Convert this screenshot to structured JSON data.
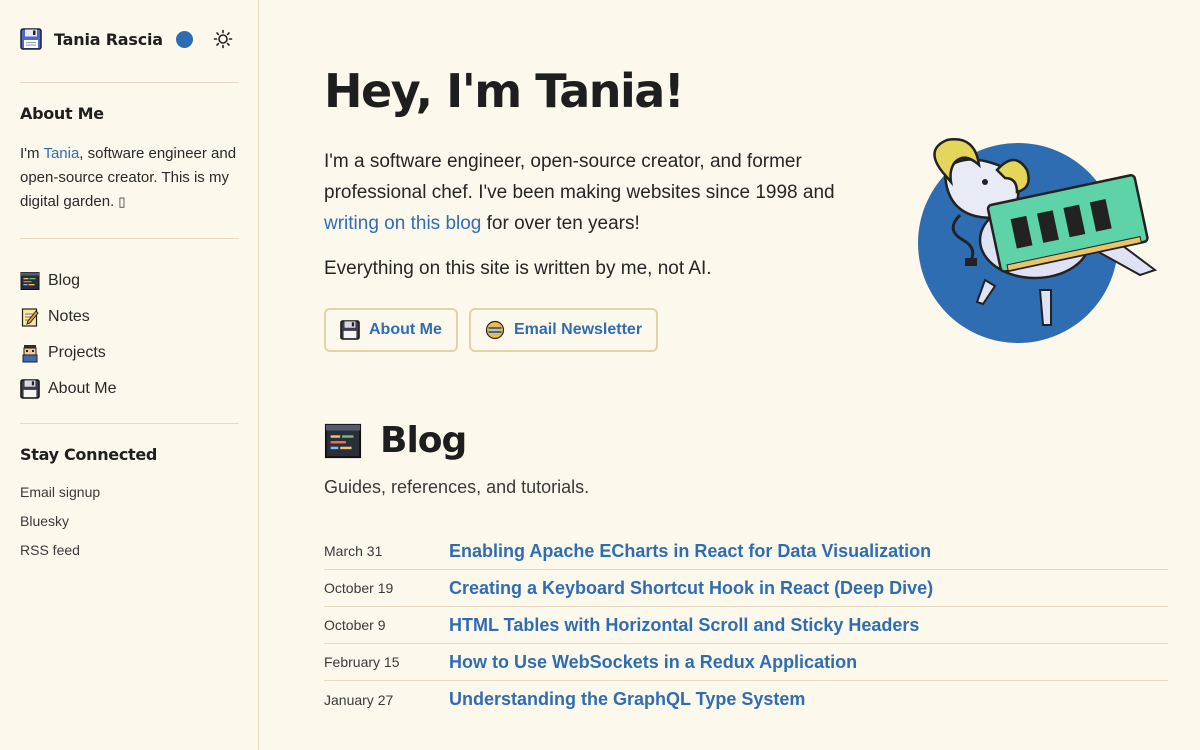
{
  "site": {
    "name": "Tania Rascia"
  },
  "sidebar": {
    "about_heading": "About Me",
    "about_prefix": "I'm ",
    "about_link": "Tania",
    "about_suffix": ", software engineer and open-source creator. This is my digital garden. ",
    "about_glyph": "▯",
    "nav": [
      {
        "label": "Blog",
        "icon": "terminal-icon"
      },
      {
        "label": "Notes",
        "icon": "notepad-icon"
      },
      {
        "label": "Projects",
        "icon": "character-icon"
      },
      {
        "label": "About Me",
        "icon": "floppy-disk-icon"
      }
    ],
    "connect_heading": "Stay Connected",
    "links": [
      "Email signup",
      "Bluesky",
      "RSS feed"
    ]
  },
  "hero": {
    "title": "Hey, I'm Tania!",
    "intro_1": "I'm a software engineer, open-source creator, and former professional chef. I've been making websites since 1998 and ",
    "intro_link": "writing on this blog",
    "intro_2": " for over ten years!",
    "intro_line2": "Everything on this site is written by me, not AI.",
    "buttons": {
      "about": "About Me",
      "newsletter": "Email Newsletter"
    }
  },
  "blog": {
    "heading": "Blog",
    "subtitle": "Guides, references, and tutorials.",
    "posts": [
      {
        "date": "March 31",
        "title": "Enabling Apache ECharts in React for Data Visualization"
      },
      {
        "date": "October 19",
        "title": "Creating a Keyboard Shortcut Hook in React (Deep Dive)"
      },
      {
        "date": "October 9",
        "title": "HTML Tables with Horizontal Scroll and Sticky Headers"
      },
      {
        "date": "February 15",
        "title": "How to Use WebSockets in a Redux Application"
      },
      {
        "date": "January 27",
        "title": "Understanding the GraphQL Type System"
      }
    ]
  },
  "colors": {
    "background": "#fdf8ec",
    "accent": "#2f6db3",
    "button_border": "#e0d4a8"
  }
}
